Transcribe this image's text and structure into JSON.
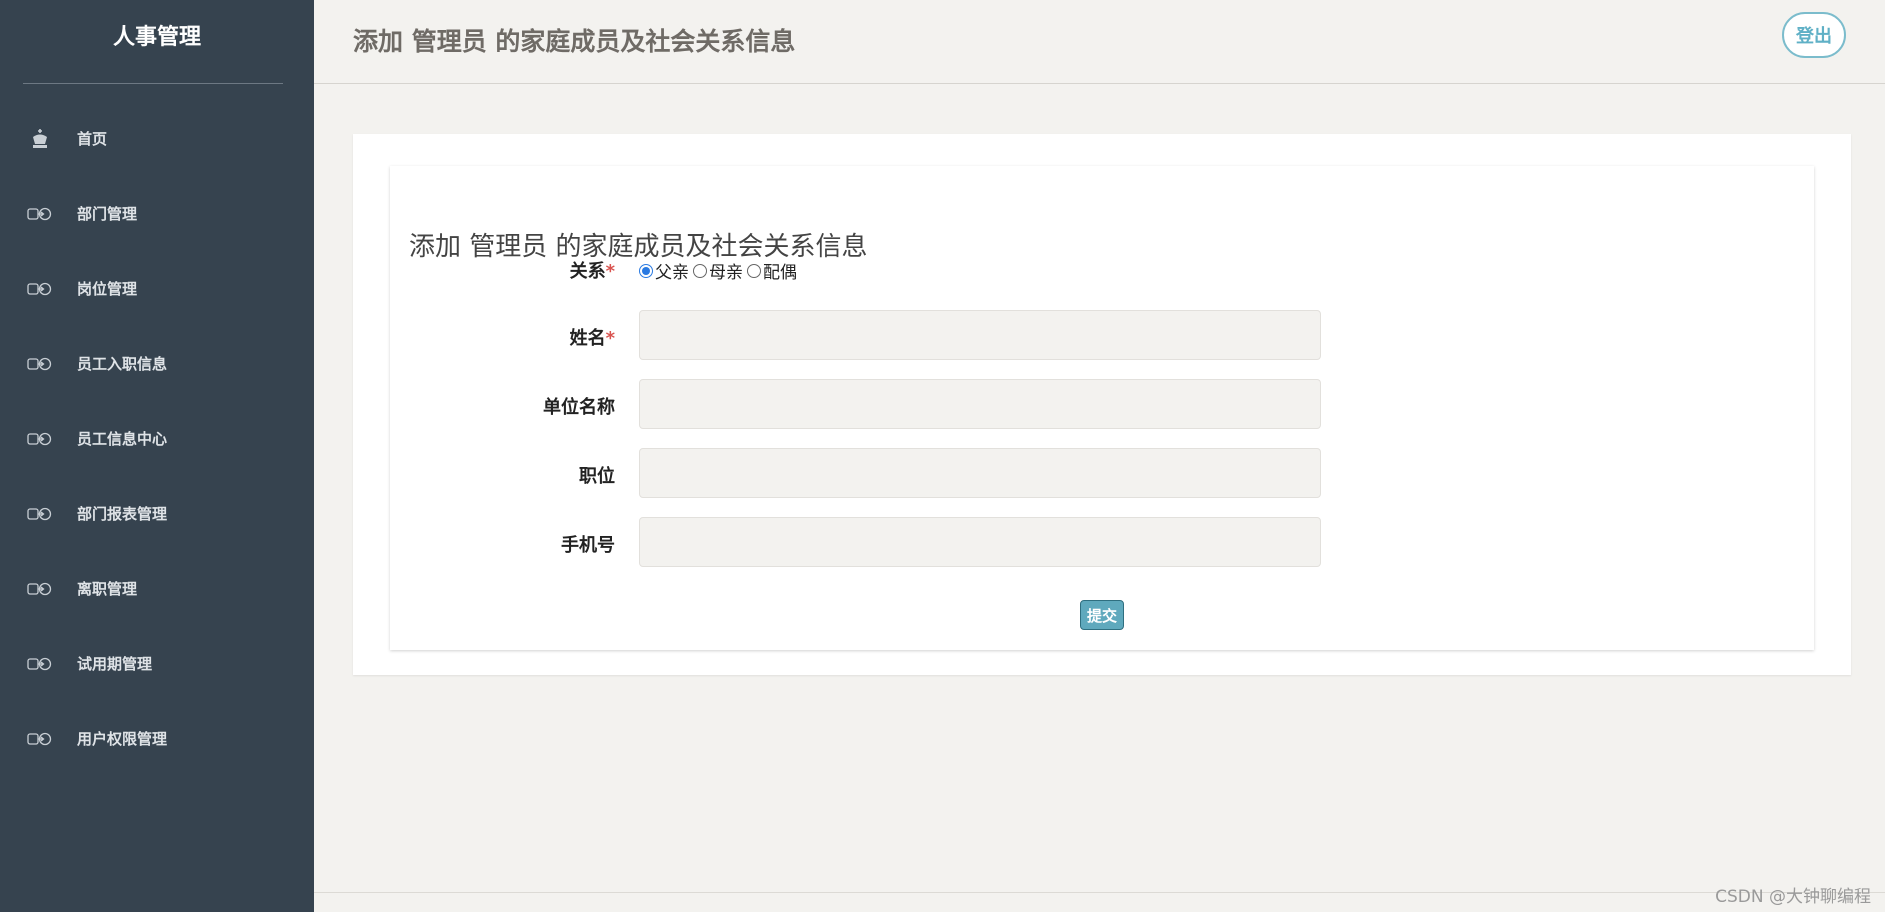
{
  "sidebar": {
    "brand": "人事管理",
    "items": [
      {
        "label": "首页",
        "icon": "chess-king-icon"
      },
      {
        "label": "部门管理",
        "icon": "toggle-arrow-icon"
      },
      {
        "label": "岗位管理",
        "icon": "toggle-arrow-icon"
      },
      {
        "label": "员工入职信息",
        "icon": "toggle-arrow-icon"
      },
      {
        "label": "员工信息中心",
        "icon": "toggle-arrow-icon"
      },
      {
        "label": "部门报表管理",
        "icon": "toggle-arrow-icon"
      },
      {
        "label": "离职管理",
        "icon": "toggle-arrow-icon"
      },
      {
        "label": "试用期管理",
        "icon": "toggle-arrow-icon"
      },
      {
        "label": "用户权限管理",
        "icon": "toggle-arrow-icon"
      }
    ]
  },
  "header": {
    "title": "添加 管理员 的家庭成员及社会关系信息",
    "logout": "登出"
  },
  "form": {
    "title": "添加 管理员 的家庭成员及社会关系信息",
    "relation": {
      "label": "关系",
      "required_mark": "*",
      "options": [
        "父亲",
        "母亲",
        "配偶"
      ],
      "selected": "父亲"
    },
    "name": {
      "label": "姓名",
      "required_mark": "*",
      "value": ""
    },
    "company": {
      "label": "单位名称",
      "value": ""
    },
    "position": {
      "label": "职位",
      "value": ""
    },
    "phone": {
      "label": "手机号",
      "value": ""
    },
    "submit": "提交"
  },
  "watermark": "CSDN @大钟聊编程",
  "colors": {
    "sidebar_bg": "#36434f",
    "page_bg": "#f3f2ef",
    "accent": "#5fa9bd",
    "required": "#d9534f"
  }
}
